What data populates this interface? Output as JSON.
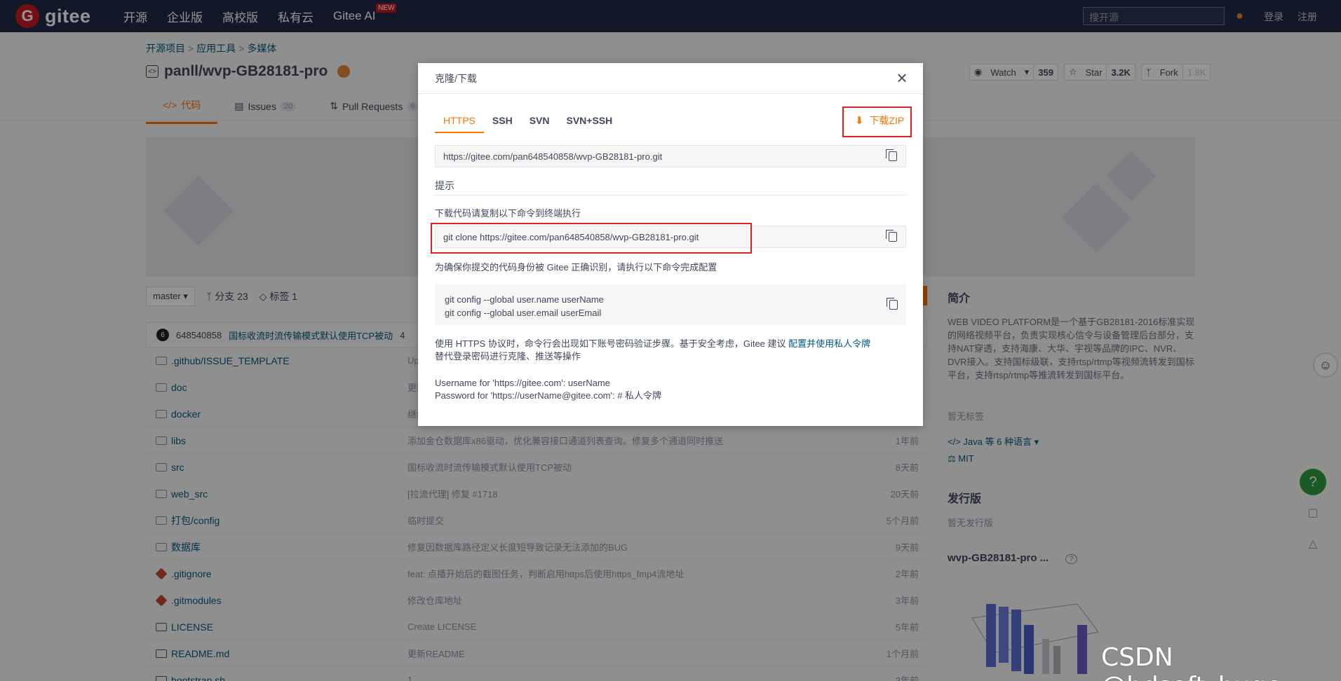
{
  "nav": {
    "logo_letter": "G",
    "logo_text": "gitee",
    "items": [
      "开源",
      "企业版",
      "高校版",
      "私有云",
      "Gitee AI"
    ],
    "new_badge": "NEW",
    "search_placeholder": "搜开源",
    "login": "登录",
    "register": "注册"
  },
  "breadcrumb": [
    "开源项目",
    "应用工具",
    "多媒体"
  ],
  "repo": {
    "name": "panll/wvp-GB28181-pro",
    "watch_label": "Watch",
    "watch_count": "359",
    "star_label": "Star",
    "star_count": "3.2K",
    "fork_label": "Fork",
    "fork_count": "1.8K"
  },
  "tabs": [
    {
      "label": "代码",
      "badge": ""
    },
    {
      "label": "Issues",
      "badge": "20"
    },
    {
      "label": "Pull Requests",
      "badge": "6"
    }
  ],
  "branch": {
    "current": "master",
    "branches": "分支 23",
    "tags": "标签 1"
  },
  "commit": {
    "avatar": "6",
    "author": "648540858",
    "message": "国标收流时流传输模式默认使用TCP被动",
    "extra": "4"
  },
  "files": [
    {
      "name": ".github/ISSUE_TEMPLATE",
      "msg": "Upda",
      "time": "",
      "type": "folder"
    },
    {
      "name": "doc",
      "msg": "更新R",
      "time": "",
      "type": "folder"
    },
    {
      "name": "docker",
      "msg": "继续(",
      "time": "",
      "type": "folder"
    },
    {
      "name": "libs",
      "msg": "添加金仓数据库x86驱动，优化兼容接口通道列表查询。修复多个通道同时推送",
      "time": "1年前",
      "type": "folder"
    },
    {
      "name": "src",
      "msg": "国标收流时流传输模式默认使用TCP被动",
      "time": "8天前",
      "type": "folder"
    },
    {
      "name": "web_src",
      "msg": "[拉流代理] 修复 #1718",
      "time": "20天前",
      "type": "folder"
    },
    {
      "name": "打包/config",
      "msg": "临时提交",
      "time": "5个月前",
      "type": "folder"
    },
    {
      "name": "数据库",
      "msg": "修复因数据库路径定义长度短导致记录无法添加的BUG",
      "time": "9天前",
      "type": "folder"
    },
    {
      "name": ".gitignore",
      "msg": "feat: 点播开始后的截图任务，判断启用https后使用https_fmp4流地址",
      "time": "2年前",
      "type": "git"
    },
    {
      "name": ".gitmodules",
      "msg": "修改仓库地址",
      "time": "3年前",
      "type": "git"
    },
    {
      "name": "LICENSE",
      "msg": "Create LICENSE",
      "time": "5年前",
      "type": "doc"
    },
    {
      "name": "README.md",
      "msg": "更新README",
      "time": "1个月前",
      "type": "doc"
    },
    {
      "name": "bootstrap.sh",
      "msg": "1",
      "time": "3年前",
      "type": "doc"
    }
  ],
  "sidebar": {
    "intro_title": "简介",
    "intro_text": "WEB VIDEO PLATFORM是一个基于GB28181-2016标准实现的网络视频平台，负责实现核心信令与设备管理后台部分，支持NAT穿透，支持海康、大华、宇视等品牌的IPC、NVR、DVR接入。支持国标级联，支持rtsp/rtmp等视频流转发到国标平台，支持rtsp/rtmp等推流转发到国标平台。",
    "no_tags": "暂无标签",
    "language": "Java 等 6 种语言",
    "license": "MIT",
    "release_title": "发行版",
    "no_release": "暂无发行版",
    "contrib_title": "wvp-GB28181-pro ...",
    "help_icon": "?"
  },
  "modal": {
    "title": "克隆/下载",
    "protocols": [
      "HTTPS",
      "SSH",
      "SVN",
      "SVN+SSH"
    ],
    "download_zip": "下载ZIP",
    "repo_url": "https://gitee.com/pan648540858/wvp-GB28181-pro.git",
    "hint_title": "提示",
    "clone_instruction": "下载代码请复制以下命令到终端执行",
    "clone_cmd": "git clone https://gitee.com/pan648540858/wvp-GB28181-pro.git",
    "identity_instruction": "为确保你提交的代码身份被 Gitee 正确识别，请执行以下命令完成配置",
    "config_line1": "git config --global user.name userName",
    "config_line2": "git config --global user.email userEmail",
    "https_note_prefix": "使用 HTTPS 协议时，命令行会出现如下账号密码验证步骤。基于安全考虑，Gitee 建议",
    "https_note_link": "配置并使用私人令牌",
    "https_note_suffix": "替代登录密码进行克隆、推送等操作",
    "username_line": "Username for 'https://gitee.com': userName",
    "password_line": "Password for 'https://userName@gitee.com': # 私人令牌"
  },
  "watermark": "CSDN @hdsoft_huge",
  "colors": {
    "accent": "#fe7300",
    "nav_bg": "#1f2a44",
    "highlight": "#e02020",
    "link": "#005980"
  }
}
